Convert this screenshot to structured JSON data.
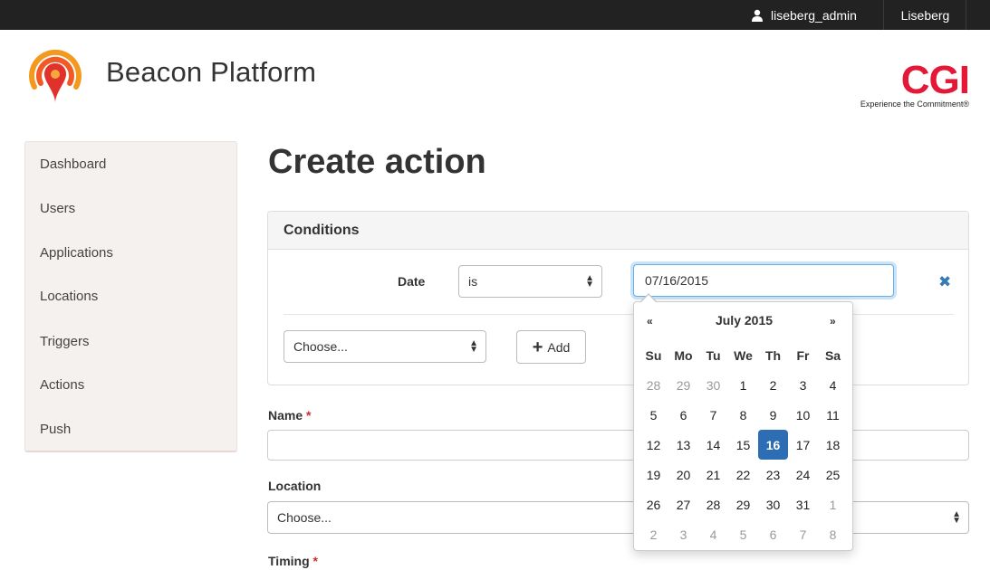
{
  "topbar": {
    "username": "liseberg_admin",
    "organization": "Liseberg"
  },
  "brand": {
    "name": "Beacon Platform",
    "partner_mark": "CGI",
    "partner_tagline": "Experience the Commitment®"
  },
  "sidebar": {
    "items": [
      {
        "label": "Dashboard"
      },
      {
        "label": "Users"
      },
      {
        "label": "Applications"
      },
      {
        "label": "Locations"
      },
      {
        "label": "Triggers"
      },
      {
        "label": "Actions"
      },
      {
        "label": "Push"
      }
    ]
  },
  "page": {
    "title": "Create action"
  },
  "conditions": {
    "heading": "Conditions",
    "date_label": "Date",
    "operator_value": "is",
    "date_value": "07/16/2015",
    "new_condition_value": "Choose...",
    "add_label": "Add"
  },
  "form": {
    "name_label": "Name",
    "required_mark": "*",
    "name_value": "",
    "location_label": "Location",
    "location_value": "Choose...",
    "timing_label": "Timing"
  },
  "datepicker": {
    "prev": "«",
    "next": "»",
    "month_title": "July 2015",
    "weekdays": [
      "Su",
      "Mo",
      "Tu",
      "We",
      "Th",
      "Fr",
      "Sa"
    ],
    "days": [
      [
        "28",
        "29",
        "30",
        "1",
        "2",
        "3",
        "4"
      ],
      [
        "5",
        "6",
        "7",
        "8",
        "9",
        "10",
        "11"
      ],
      [
        "12",
        "13",
        "14",
        "15",
        "16",
        "17",
        "18"
      ],
      [
        "19",
        "20",
        "21",
        "22",
        "23",
        "24",
        "25"
      ],
      [
        "26",
        "27",
        "28",
        "29",
        "30",
        "31",
        "1"
      ],
      [
        "2",
        "3",
        "4",
        "5",
        "6",
        "7",
        "8"
      ]
    ],
    "selected": "16",
    "colors": {
      "selected": "#2d6db3",
      "muted_text": "#999999"
    }
  },
  "colors": {
    "topbar": "#222222",
    "accent_red": "#e31937",
    "link_blue": "#337ab7"
  }
}
